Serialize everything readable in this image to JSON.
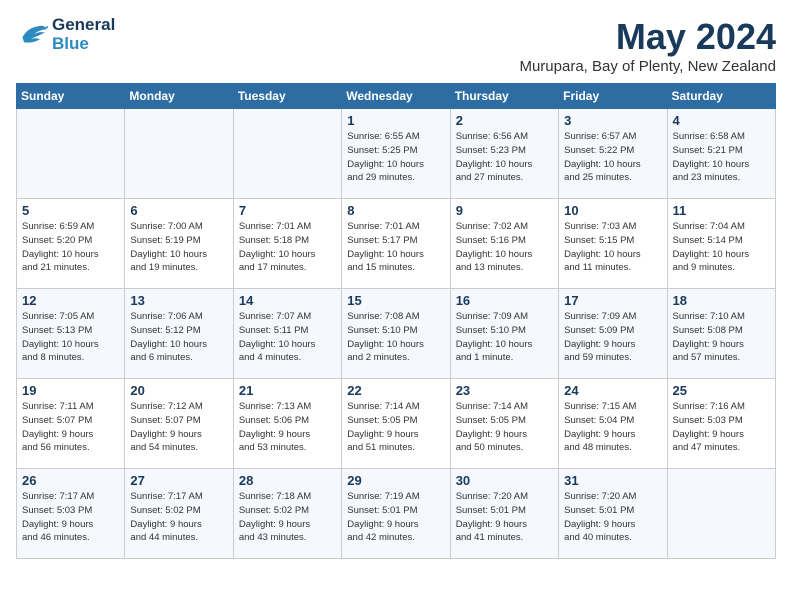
{
  "logo": {
    "line1": "General",
    "line2": "Blue"
  },
  "title": "May 2024",
  "location": "Murupara, Bay of Plenty, New Zealand",
  "days_header": [
    "Sunday",
    "Monday",
    "Tuesday",
    "Wednesday",
    "Thursday",
    "Friday",
    "Saturday"
  ],
  "weeks": [
    {
      "cells": [
        {
          "day": "",
          "info": ""
        },
        {
          "day": "",
          "info": ""
        },
        {
          "day": "",
          "info": ""
        },
        {
          "day": "1",
          "info": "Sunrise: 6:55 AM\nSunset: 5:25 PM\nDaylight: 10 hours\nand 29 minutes."
        },
        {
          "day": "2",
          "info": "Sunrise: 6:56 AM\nSunset: 5:23 PM\nDaylight: 10 hours\nand 27 minutes."
        },
        {
          "day": "3",
          "info": "Sunrise: 6:57 AM\nSunset: 5:22 PM\nDaylight: 10 hours\nand 25 minutes."
        },
        {
          "day": "4",
          "info": "Sunrise: 6:58 AM\nSunset: 5:21 PM\nDaylight: 10 hours\nand 23 minutes."
        }
      ]
    },
    {
      "cells": [
        {
          "day": "5",
          "info": "Sunrise: 6:59 AM\nSunset: 5:20 PM\nDaylight: 10 hours\nand 21 minutes."
        },
        {
          "day": "6",
          "info": "Sunrise: 7:00 AM\nSunset: 5:19 PM\nDaylight: 10 hours\nand 19 minutes."
        },
        {
          "day": "7",
          "info": "Sunrise: 7:01 AM\nSunset: 5:18 PM\nDaylight: 10 hours\nand 17 minutes."
        },
        {
          "day": "8",
          "info": "Sunrise: 7:01 AM\nSunset: 5:17 PM\nDaylight: 10 hours\nand 15 minutes."
        },
        {
          "day": "9",
          "info": "Sunrise: 7:02 AM\nSunset: 5:16 PM\nDaylight: 10 hours\nand 13 minutes."
        },
        {
          "day": "10",
          "info": "Sunrise: 7:03 AM\nSunset: 5:15 PM\nDaylight: 10 hours\nand 11 minutes."
        },
        {
          "day": "11",
          "info": "Sunrise: 7:04 AM\nSunset: 5:14 PM\nDaylight: 10 hours\nand 9 minutes."
        }
      ]
    },
    {
      "cells": [
        {
          "day": "12",
          "info": "Sunrise: 7:05 AM\nSunset: 5:13 PM\nDaylight: 10 hours\nand 8 minutes."
        },
        {
          "day": "13",
          "info": "Sunrise: 7:06 AM\nSunset: 5:12 PM\nDaylight: 10 hours\nand 6 minutes."
        },
        {
          "day": "14",
          "info": "Sunrise: 7:07 AM\nSunset: 5:11 PM\nDaylight: 10 hours\nand 4 minutes."
        },
        {
          "day": "15",
          "info": "Sunrise: 7:08 AM\nSunset: 5:10 PM\nDaylight: 10 hours\nand 2 minutes."
        },
        {
          "day": "16",
          "info": "Sunrise: 7:09 AM\nSunset: 5:10 PM\nDaylight: 10 hours\nand 1 minute."
        },
        {
          "day": "17",
          "info": "Sunrise: 7:09 AM\nSunset: 5:09 PM\nDaylight: 9 hours\nand 59 minutes."
        },
        {
          "day": "18",
          "info": "Sunrise: 7:10 AM\nSunset: 5:08 PM\nDaylight: 9 hours\nand 57 minutes."
        }
      ]
    },
    {
      "cells": [
        {
          "day": "19",
          "info": "Sunrise: 7:11 AM\nSunset: 5:07 PM\nDaylight: 9 hours\nand 56 minutes."
        },
        {
          "day": "20",
          "info": "Sunrise: 7:12 AM\nSunset: 5:07 PM\nDaylight: 9 hours\nand 54 minutes."
        },
        {
          "day": "21",
          "info": "Sunrise: 7:13 AM\nSunset: 5:06 PM\nDaylight: 9 hours\nand 53 minutes."
        },
        {
          "day": "22",
          "info": "Sunrise: 7:14 AM\nSunset: 5:05 PM\nDaylight: 9 hours\nand 51 minutes."
        },
        {
          "day": "23",
          "info": "Sunrise: 7:14 AM\nSunset: 5:05 PM\nDaylight: 9 hours\nand 50 minutes."
        },
        {
          "day": "24",
          "info": "Sunrise: 7:15 AM\nSunset: 5:04 PM\nDaylight: 9 hours\nand 48 minutes."
        },
        {
          "day": "25",
          "info": "Sunrise: 7:16 AM\nSunset: 5:03 PM\nDaylight: 9 hours\nand 47 minutes."
        }
      ]
    },
    {
      "cells": [
        {
          "day": "26",
          "info": "Sunrise: 7:17 AM\nSunset: 5:03 PM\nDaylight: 9 hours\nand 46 minutes."
        },
        {
          "day": "27",
          "info": "Sunrise: 7:17 AM\nSunset: 5:02 PM\nDaylight: 9 hours\nand 44 minutes."
        },
        {
          "day": "28",
          "info": "Sunrise: 7:18 AM\nSunset: 5:02 PM\nDaylight: 9 hours\nand 43 minutes."
        },
        {
          "day": "29",
          "info": "Sunrise: 7:19 AM\nSunset: 5:01 PM\nDaylight: 9 hours\nand 42 minutes."
        },
        {
          "day": "30",
          "info": "Sunrise: 7:20 AM\nSunset: 5:01 PM\nDaylight: 9 hours\nand 41 minutes."
        },
        {
          "day": "31",
          "info": "Sunrise: 7:20 AM\nSunset: 5:01 PM\nDaylight: 9 hours\nand 40 minutes."
        },
        {
          "day": "",
          "info": ""
        }
      ]
    }
  ]
}
